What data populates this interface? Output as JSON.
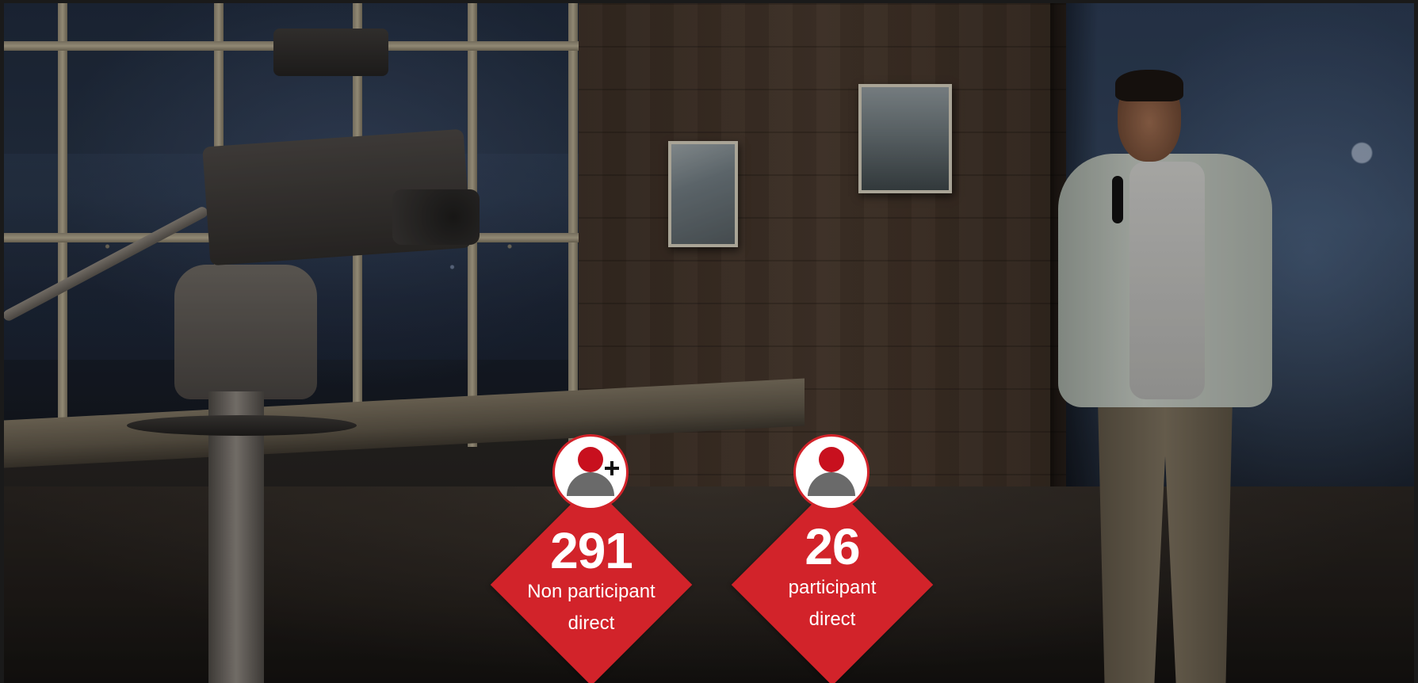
{
  "stats": [
    {
      "value": "291",
      "label": "Non participant direct",
      "icon": "user-add-icon"
    },
    {
      "value": "26",
      "label": "participant direct",
      "icon": "user-icon"
    }
  ],
  "colors": {
    "accent_red": "#d2232a",
    "icon_head_red": "#c8101e",
    "icon_body_gray": "#6a6a6a",
    "text_white": "#ffffff"
  },
  "background": {
    "icon": "tv-studio-photo"
  }
}
